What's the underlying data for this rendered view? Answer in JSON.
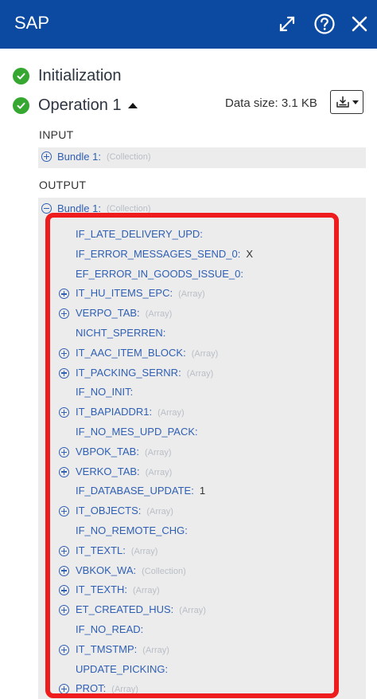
{
  "header": {
    "title": "SAP"
  },
  "status": [
    {
      "label": "Initialization"
    },
    {
      "label": "Operation 1"
    }
  ],
  "data_size": "Data size: 3.1 KB",
  "input": {
    "label": "INPUT",
    "bundle": {
      "label": "Bundle 1:",
      "type": "(Collection)"
    }
  },
  "output": {
    "label": "OUTPUT",
    "bundle": {
      "label": "Bundle 1:",
      "type": "(Collection)"
    },
    "items": [
      {
        "name": "IF_LATE_DELIVERY_UPD:",
        "expandable": false,
        "value": "",
        "type": ""
      },
      {
        "name": "IF_ERROR_MESSAGES_SEND_0:",
        "expandable": false,
        "value": "X",
        "type": ""
      },
      {
        "name": "EF_ERROR_IN_GOODS_ISSUE_0:",
        "expandable": false,
        "value": "",
        "type": ""
      },
      {
        "name": "IT_HU_ITEMS_EPC:",
        "expandable": true,
        "value": "",
        "type": "(Array)"
      },
      {
        "name": "VERPO_TAB:",
        "expandable": true,
        "value": "",
        "type": "(Array)"
      },
      {
        "name": "NICHT_SPERREN:",
        "expandable": false,
        "value": "",
        "type": ""
      },
      {
        "name": "IT_AAC_ITEM_BLOCK:",
        "expandable": true,
        "value": "",
        "type": "(Array)"
      },
      {
        "name": "IT_PACKING_SERNR:",
        "expandable": true,
        "value": "",
        "type": "(Array)"
      },
      {
        "name": "IF_NO_INIT:",
        "expandable": false,
        "value": "",
        "type": ""
      },
      {
        "name": "IT_BAPIADDR1:",
        "expandable": true,
        "value": "",
        "type": "(Array)"
      },
      {
        "name": "IF_NO_MES_UPD_PACK:",
        "expandable": false,
        "value": "",
        "type": ""
      },
      {
        "name": "VBPOK_TAB:",
        "expandable": true,
        "value": "",
        "type": "(Array)"
      },
      {
        "name": "VERKO_TAB:",
        "expandable": true,
        "value": "",
        "type": "(Array)"
      },
      {
        "name": "IF_DATABASE_UPDATE:",
        "expandable": false,
        "value": "1",
        "type": ""
      },
      {
        "name": "IT_OBJECTS:",
        "expandable": true,
        "value": "",
        "type": "(Array)"
      },
      {
        "name": "IF_NO_REMOTE_CHG:",
        "expandable": false,
        "value": "",
        "type": ""
      },
      {
        "name": "IT_TEXTL:",
        "expandable": true,
        "value": "",
        "type": "(Array)"
      },
      {
        "name": "VBKOK_WA:",
        "expandable": true,
        "value": "",
        "type": "(Collection)"
      },
      {
        "name": "IT_TEXTH:",
        "expandable": true,
        "value": "",
        "type": "(Array)"
      },
      {
        "name": "ET_CREATED_HUS:",
        "expandable": true,
        "value": "",
        "type": "(Array)"
      },
      {
        "name": "IF_NO_READ:",
        "expandable": false,
        "value": "",
        "type": ""
      },
      {
        "name": "IT_TMSTMP:",
        "expandable": true,
        "value": "",
        "type": "(Array)"
      },
      {
        "name": "UPDATE_PICKING:",
        "expandable": false,
        "value": "",
        "type": ""
      },
      {
        "name": "PROT:",
        "expandable": true,
        "value": "",
        "type": "(Array)"
      }
    ]
  },
  "colors": {
    "header_bg": "#0b4aa0",
    "success_green": "#36a832",
    "link_blue": "#2f5fb3",
    "highlight_red": "#ee1c1c"
  },
  "icons": {
    "expand": "expand-arrows-icon",
    "help": "question-circle-icon",
    "close": "close-icon",
    "download": "download-tray-icon"
  }
}
